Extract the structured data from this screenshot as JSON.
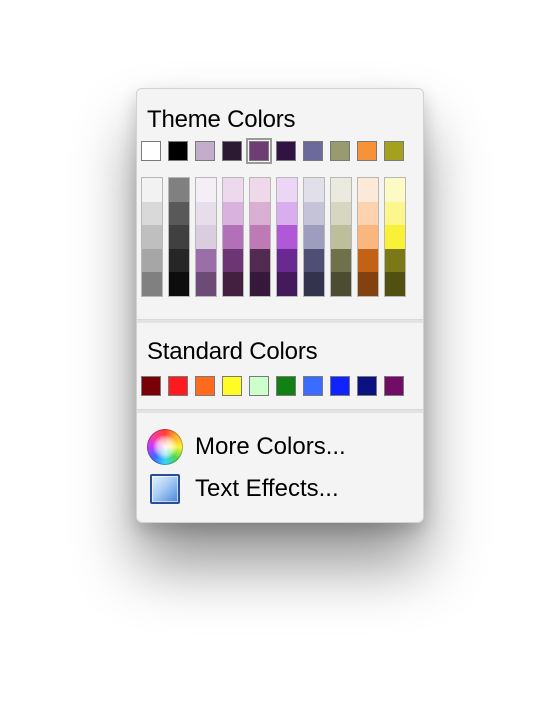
{
  "popup": {
    "theme_title": "Theme Colors",
    "standard_title": "Standard Colors",
    "more_colors_label": "More Colors...",
    "text_effects_label": "Text Effects..."
  },
  "theme_colors": [
    "#ffffff",
    "#000000",
    "#c2aecb",
    "#2c1a32",
    "#6e3d73",
    "#301342",
    "#6c6a9b",
    "#989a70",
    "#f8923a",
    "#a4a11f"
  ],
  "selected_theme_index": 4,
  "theme_shades": [
    [
      "#f2f2f2",
      "#d9d9d9",
      "#bfbfbf",
      "#a6a6a6",
      "#808080"
    ],
    [
      "#808080",
      "#595959",
      "#404040",
      "#262626",
      "#0d0d0d"
    ],
    [
      "#f3eff5",
      "#e6deeb",
      "#dacde0",
      "#9a6fa8",
      "#6c4c76"
    ],
    [
      "#ecd9ee",
      "#d9b3dd",
      "#b170b8",
      "#6e3574",
      "#43203f"
    ],
    [
      "#eed8ea",
      "#d9b0d3",
      "#bd7ab4",
      "#532a50",
      "#36193a"
    ],
    [
      "#ecd6f6",
      "#d9adee",
      "#af58d8",
      "#6a2990",
      "#441a5c"
    ],
    [
      "#e1e0ea",
      "#c4c3d8",
      "#9e9dbf",
      "#4f4e74",
      "#34334d"
    ],
    [
      "#eaeadf",
      "#d6d6c2",
      "#bdbe9b",
      "#6f714b",
      "#4b4c32"
    ],
    [
      "#fde9d7",
      "#fcd3ae",
      "#fab67c",
      "#c36216",
      "#82410f"
    ],
    [
      "#fdfbc4",
      "#fcf78c",
      "#f9f135",
      "#7b7817",
      "#525010"
    ]
  ],
  "standard_colors": [
    "#7a0008",
    "#ff1a1f",
    "#ff6a1e",
    "#fffb25",
    "#ccffcc",
    "#138014",
    "#3a6dff",
    "#0f23ff",
    "#0a1180",
    "#720c65"
  ],
  "icons": {
    "more_colors": "color-wheel-icon",
    "text_effects": "text-effects-icon"
  }
}
